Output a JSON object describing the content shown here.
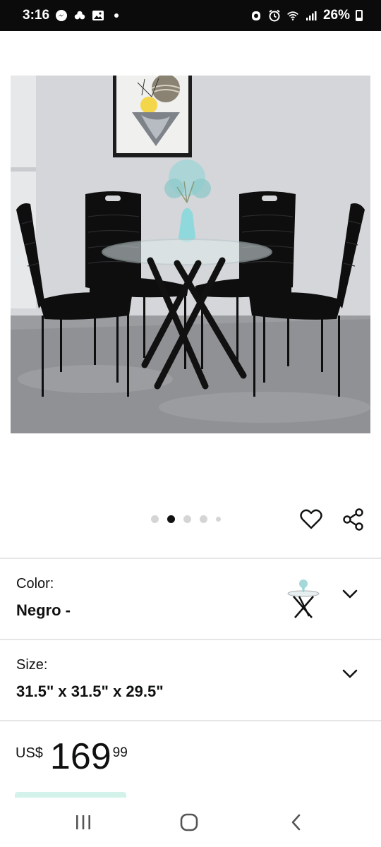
{
  "status_bar": {
    "time": "3:16",
    "battery_percent": "26%",
    "left_icons": [
      "messenger-icon",
      "cloud-group-icon",
      "gallery-icon",
      "notification-dot-icon"
    ],
    "right_icons": [
      "alarm-icon",
      "alarm-clock-icon",
      "wifi-icon",
      "signal-icon",
      "battery-icon"
    ]
  },
  "product": {
    "image_alt_subject": "round-glass-dining-table-with-four-black-velvet-chairs",
    "carousel": {
      "total_dots": 5,
      "active_index": 1
    }
  },
  "actions": {
    "favorite_icon": "heart-outline-icon",
    "share_icon": "share-icon"
  },
  "options": {
    "color": {
      "label": "Color:",
      "value": "Negro -"
    },
    "size": {
      "label": "Size:",
      "value": "31.5\" x 31.5\" x 29.5\""
    }
  },
  "price": {
    "currency": "US$",
    "whole": "169",
    "fraction": "99"
  },
  "nav": {
    "recents_icon": "recents-icon",
    "home_icon": "home-icon",
    "back_icon": "back-icon"
  },
  "colors": {
    "status_bar_bg": "#0b0b0b",
    "accent_strip": "#d3f3ea",
    "divider": "#e6e6e6"
  }
}
